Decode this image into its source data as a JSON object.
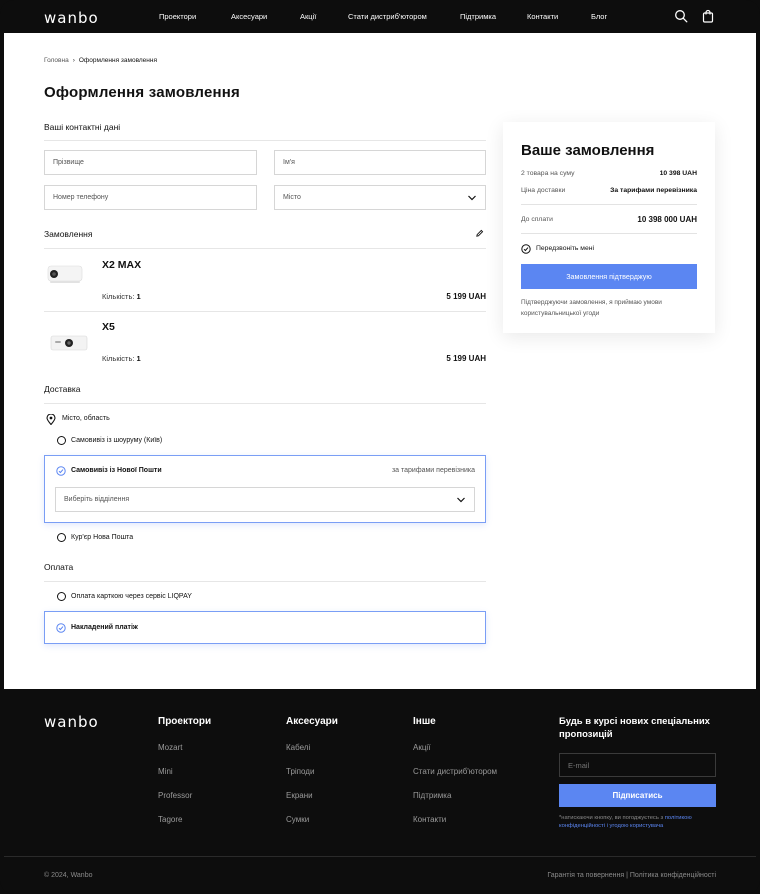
{
  "brand": "wanbo",
  "nav": [
    "Проектори",
    "Аксесуари",
    "Акції",
    "Стати дистриб'ютором",
    "Підтримка",
    "Контакти",
    "Блог"
  ],
  "breadcrumb": {
    "home": "Головна",
    "current": "Оформлення замовлення"
  },
  "page_title": "Оформлення замовлення",
  "contacts": {
    "title": "Ваші контактні дані",
    "surname_placeholder": "Прізвище",
    "name_placeholder": "Ім'я",
    "phone_placeholder": "Номер телефону",
    "city_placeholder": "Місто"
  },
  "order": {
    "title": "Замовлення",
    "items": [
      {
        "name": "X2 MAX",
        "qty_label": "Кількість:",
        "qty": "1",
        "price": "5 199 UAH"
      },
      {
        "name": "X5",
        "qty_label": "Кількість:",
        "qty": "1",
        "price": "5 199 UAH"
      }
    ]
  },
  "delivery": {
    "title": "Доставка",
    "location": "Місто, область",
    "options": [
      {
        "label": "Самовивіз із шоуруму (Київ)"
      },
      {
        "label": "Самовивіз із Нової Пошти",
        "note": "за тарифами перевізника",
        "select_placeholder": "Виберіть відділення"
      },
      {
        "label": "Кур'єр Нова Пошта"
      }
    ]
  },
  "payment": {
    "title": "Оплата",
    "options": [
      {
        "label": "Оплата карткою через сервіс LIQPAY"
      },
      {
        "label": "Накладений платіж"
      }
    ]
  },
  "summary": {
    "title": "Ваше замовлення",
    "items_label": "2 товара на суму",
    "items_value": "10 398 UAH",
    "delivery_label": "Ціна доставки",
    "delivery_value": "За тарифами перевізника",
    "total_label": "До сплати",
    "total_value": "10 398 000 UAH",
    "callback_label": "Передзвоніть мені",
    "confirm_label": "Замовлення підтверджую",
    "terms": "Підтверджуючи замовлення, я приймаю умови користувальницької угоди"
  },
  "footer": {
    "columns": [
      {
        "title": "Проектори",
        "links": [
          "Mozart",
          "Mini",
          "Professor",
          "Tagore"
        ]
      },
      {
        "title": "Аксесуари",
        "links": [
          "Кабелі",
          "Тріподи",
          "Екрани",
          "Сумки"
        ]
      },
      {
        "title": "Інше",
        "links": [
          "Акції",
          "Стати дистриб'ютором",
          "Підтримка",
          "Контакти"
        ]
      }
    ],
    "newsletter_title": "Будь в курсі нових спеціальних пропозицій",
    "email_placeholder": "E-mail",
    "subscribe_label": "Підписатись",
    "note_prefix": "*натискаючи кнопку, ви погоджуєтесь з",
    "note_link": "політикою конфіденційності і угодою користувача",
    "copyright": "© 2024, Wanbo",
    "legal": "Гарантія та повернення | Політика конфіденційності"
  },
  "colors": {
    "accent": "#5b86f2",
    "dark": "#0d0d0d",
    "selected_border": "#7a9ef5"
  },
  "icons": [
    "search-icon",
    "bag-icon",
    "edit-icon",
    "location-pin-icon",
    "chevron-down-icon",
    "check-circle-icon",
    "breadcrumb-chevron-icon"
  ]
}
